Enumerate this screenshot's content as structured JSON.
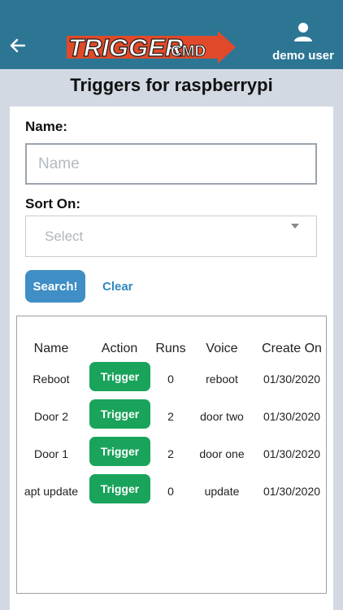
{
  "header": {
    "logo_primary": "TRIGGER",
    "logo_secondary": "CMD",
    "user_label": "demo user",
    "bg_color": "#2c7694",
    "logo_arrow_color": "#e04a2a"
  },
  "page": {
    "title": "Triggers for raspberrypi"
  },
  "form": {
    "name_label": "Name:",
    "name_placeholder": "Name",
    "name_value": "",
    "sort_label": "Sort On:",
    "sort_value": "Select",
    "search_label": "Search!",
    "clear_label": "Clear"
  },
  "table": {
    "headers": {
      "name": "Name",
      "action": "Action",
      "runs": "Runs",
      "voice": "Voice",
      "created": "Create On"
    },
    "rows": [
      {
        "name": "Reboot",
        "action": "Trigger",
        "runs": "0",
        "voice": "reboot",
        "created": "01/30/2020"
      },
      {
        "name": "Door 2",
        "action": "Trigger",
        "runs": "2",
        "voice": "door two",
        "created": "01/30/2020"
      },
      {
        "name": "Door 1",
        "action": "Trigger",
        "runs": "2",
        "voice": "door one",
        "created": "01/30/2020"
      },
      {
        "name": "apt update",
        "action": "Trigger",
        "runs": "0",
        "voice": "update",
        "created": "01/30/2020"
      }
    ]
  },
  "colors": {
    "search_button": "#3f8ec5",
    "trigger_button": "#1aa35b",
    "clear_link": "#2f89c0"
  }
}
